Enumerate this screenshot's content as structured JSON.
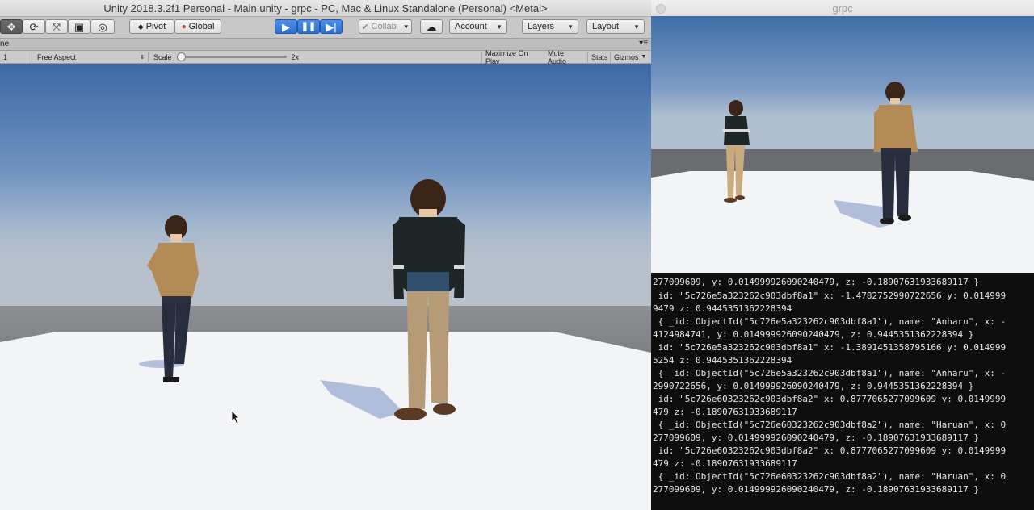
{
  "unity": {
    "title": "Unity 2018.3.2f1 Personal - Main.unity - grpc - PC, Mac & Linux Standalone (Personal) <Metal>",
    "toolbar": {
      "pivot": "Pivot",
      "global": "Global",
      "collab": "Collab",
      "account": "Account",
      "layers": "Layers",
      "layout": "Layout"
    },
    "game_tab": "ne",
    "game_bar": {
      "display": "1",
      "aspect": "Free Aspect",
      "scale_label": "Scale",
      "scale_value": "2x",
      "maximize": "Maximize On Play",
      "mute": "Mute Audio",
      "stats": "Stats",
      "gizmos": "Gizmos"
    }
  },
  "player": {
    "title": "grpc",
    "console_lines": [
      "277099609, y: 0.014999926090240479, z: -0.18907631933689117 }",
      " id: \"5c726e5a323262c903dbf8a1\" x: -1.4782752990722656 y: 0.014999",
      "9479 z: 0.9445351362228394",
      " { _id: ObjectId(\"5c726e5a323262c903dbf8a1\"), name: \"Anharu\", x: -",
      "4124984741, y: 0.014999926090240479, z: 0.9445351362228394 }",
      " id: \"5c726e5a323262c903dbf8a1\" x: -1.3891451358795166 y: 0.014999",
      "5254 z: 0.9445351362228394",
      " { _id: ObjectId(\"5c726e5a323262c903dbf8a1\"), name: \"Anharu\", x: -",
      "2990722656, y: 0.014999926090240479, z: 0.9445351362228394 }",
      " id: \"5c726e60323262c903dbf8a2\" x: 0.8777065277099609 y: 0.0149999",
      "479 z: -0.18907631933689117",
      " { _id: ObjectId(\"5c726e60323262c903dbf8a2\"), name: \"Haruan\", x: 0",
      "277099609, y: 0.014999926090240479, z: -0.18907631933689117 }",
      " id: \"5c726e60323262c903dbf8a2\" x: 0.8777065277099609 y: 0.0149999",
      "479 z: -0.18907631933689117",
      " { _id: ObjectId(\"5c726e60323262c903dbf8a2\"), name: \"Haruan\", x: 0",
      "277099609, y: 0.014999926090240479, z: -0.18907631933689117 }"
    ]
  },
  "icons": {
    "move": "move-tool-icon",
    "rotate": "rotate-tool-icon",
    "scale": "scale-tool-icon",
    "rect": "rect-tool-icon",
    "transform": "transform-tool-icon",
    "play": "play-icon",
    "pause": "pause-icon",
    "step": "step-icon",
    "cloud": "cloud-icon",
    "cursor": "mouse-cursor-icon"
  },
  "colors": {
    "sky_top": "#3f6ea8",
    "horizon": "#aeb7c2",
    "ground_below": "#5c5c5c",
    "floor": "#f2f4f6",
    "play_blue": "#2d6fd1",
    "console_bg": "#0e0e0e"
  }
}
